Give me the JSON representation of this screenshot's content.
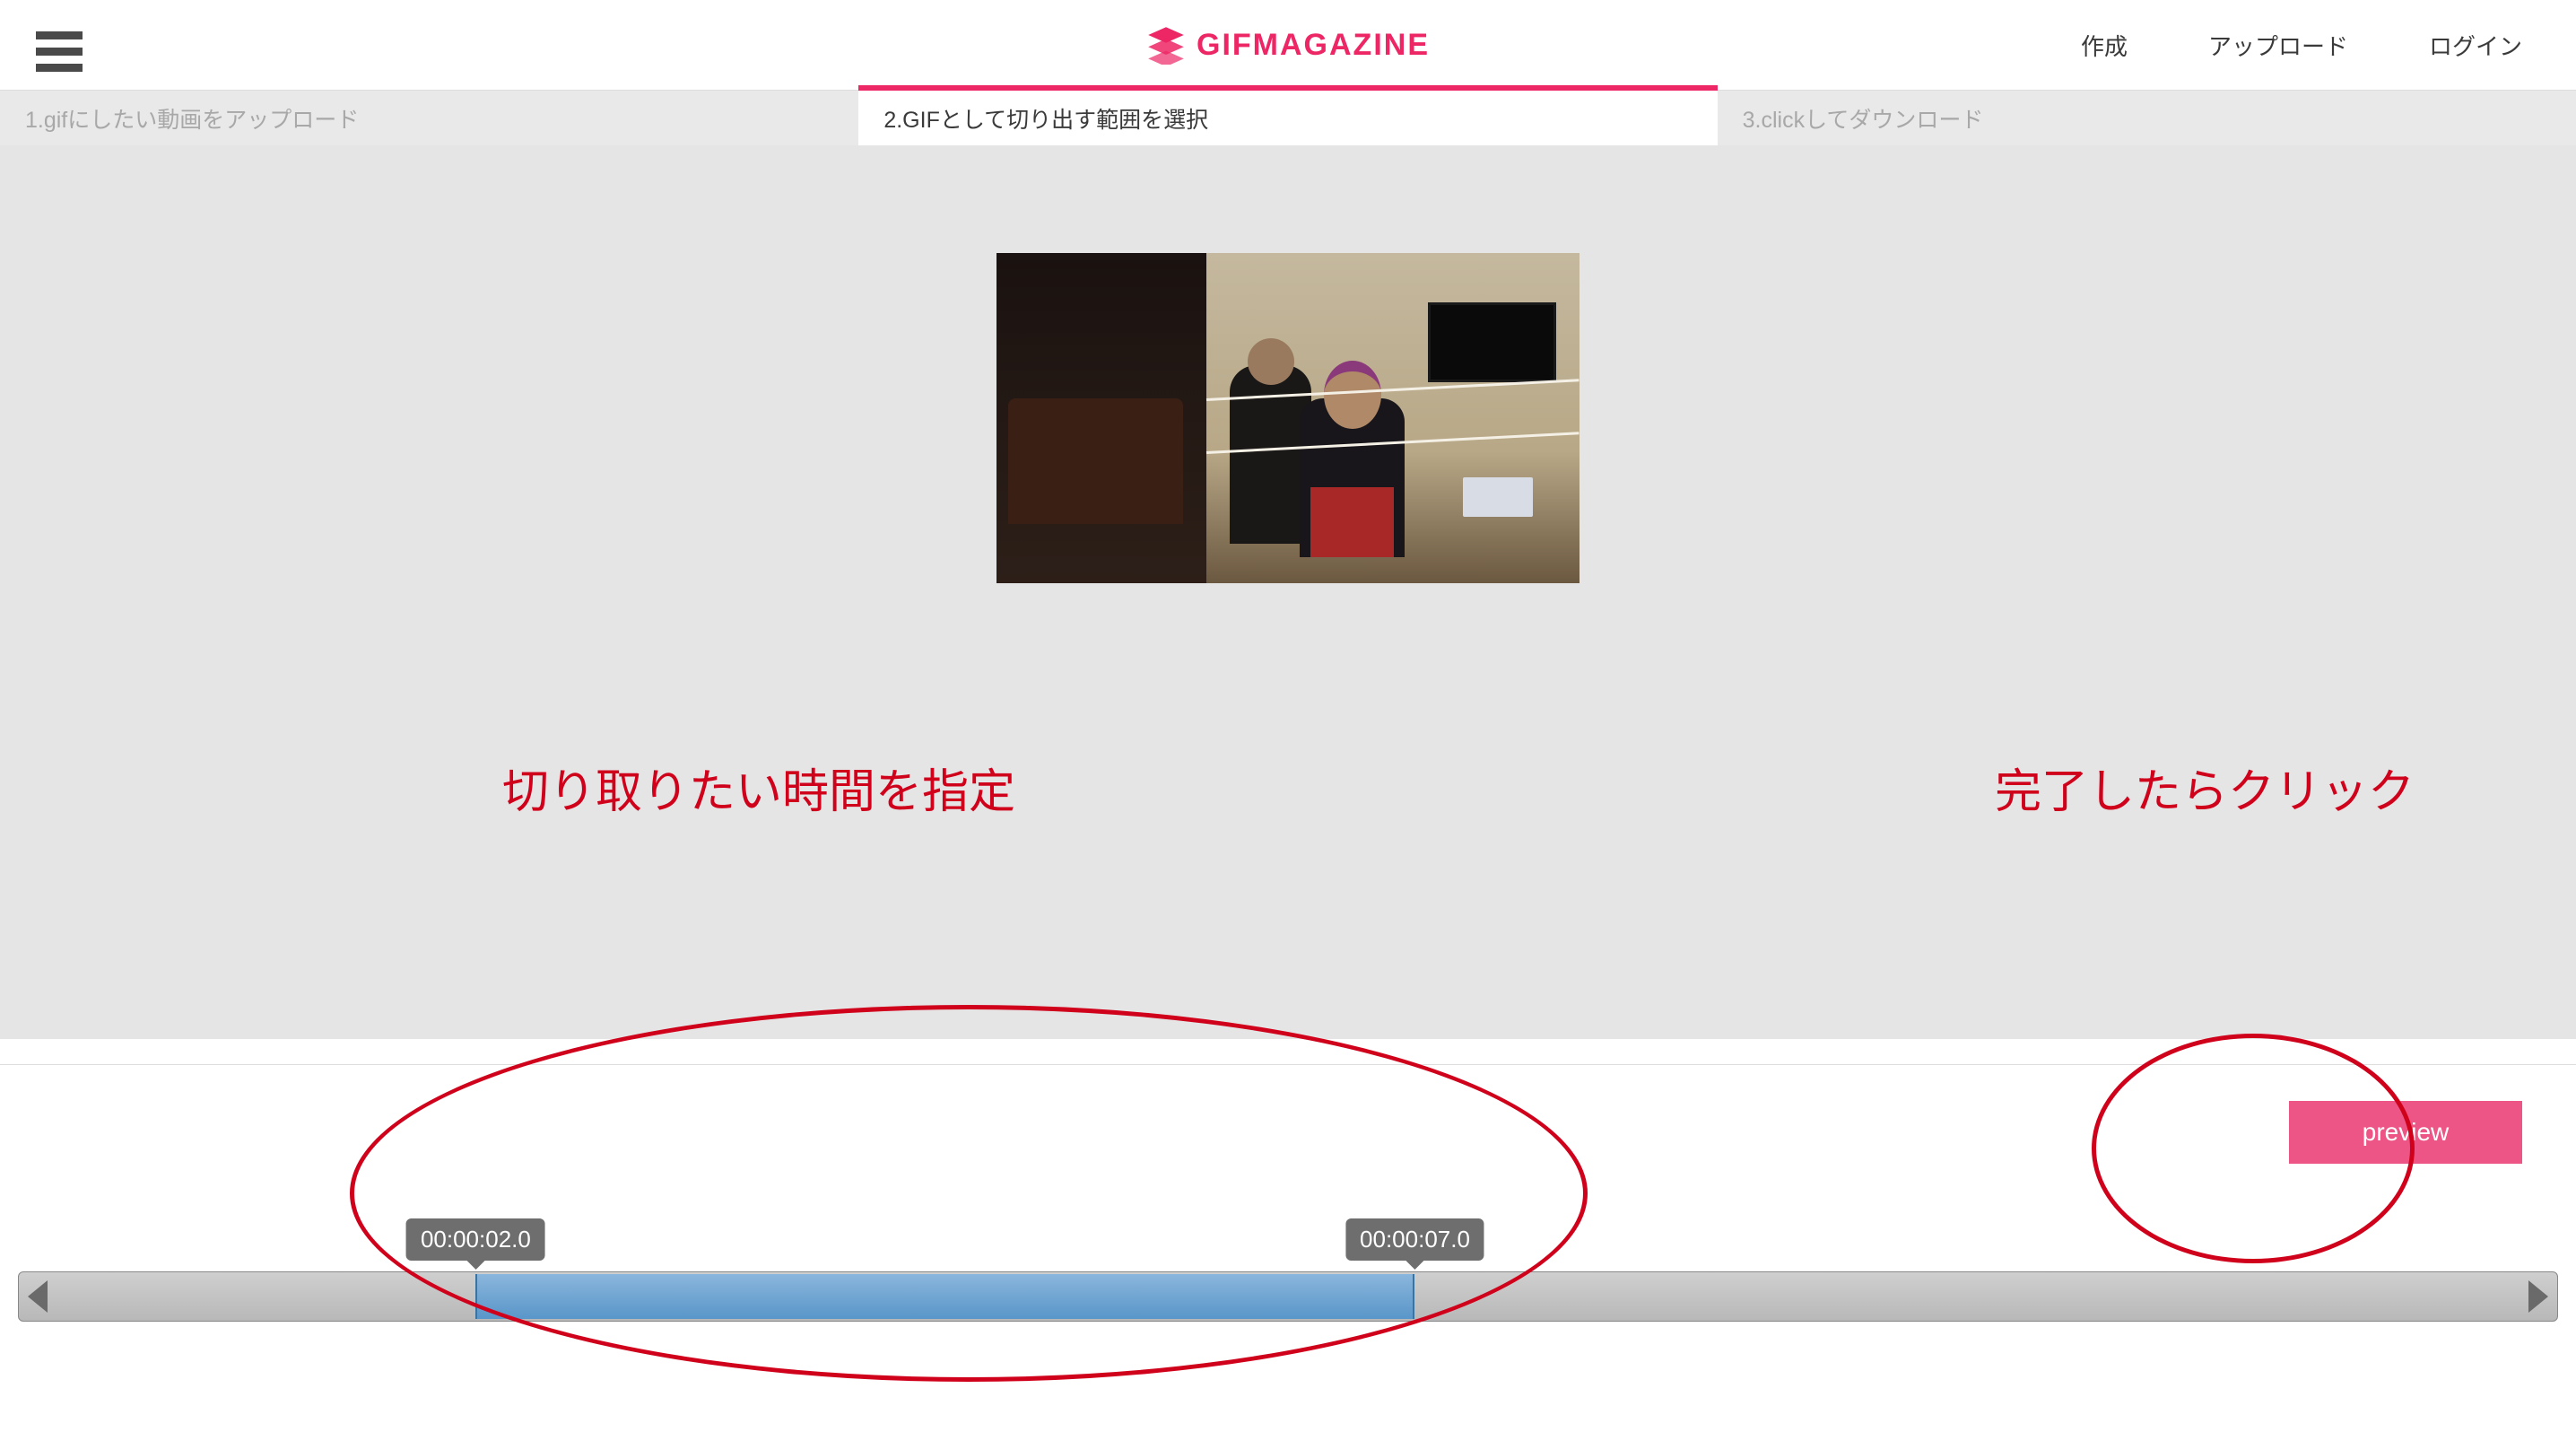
{
  "header": {
    "brand": "GIFMAGAZINE",
    "nav": {
      "create": "作成",
      "upload": "アップロード",
      "login": "ログイン"
    }
  },
  "steps": {
    "step1": "1.gifにしたい動画をアップロード",
    "step2": "2.GIFとして切り出す範囲を選択",
    "step3": "3.clickしてダウンロード"
  },
  "annotations": {
    "timeline_hint": "切り取りたい時間を指定",
    "preview_hint": "完了したらクリック"
  },
  "controls": {
    "preview_label": "preview"
  },
  "timeline": {
    "start_time": "00:00:02.0",
    "end_time": "00:00:07.0"
  }
}
